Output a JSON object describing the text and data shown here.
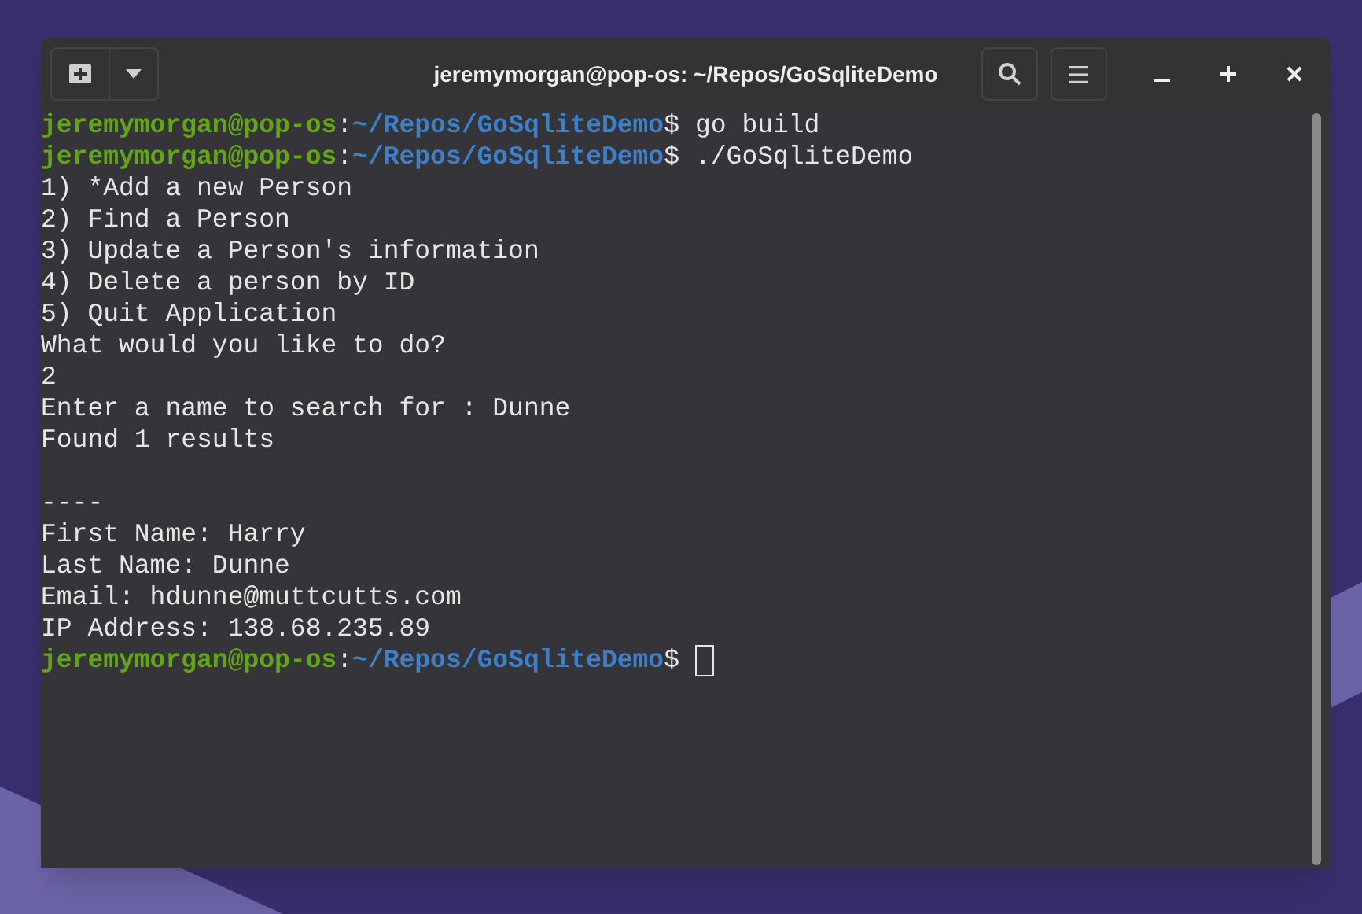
{
  "window": {
    "title": "jeremymorgan@pop-os: ~/Repos/GoSqliteDemo"
  },
  "terminal": {
    "lines": [
      {
        "kind": "prompt",
        "user": "jeremymorgan@pop-os",
        "separator": ":",
        "path": "~/Repos/GoSqliteDemo",
        "symbol": "$",
        "command": "go build"
      },
      {
        "kind": "prompt",
        "user": "jeremymorgan@pop-os",
        "separator": ":",
        "path": "~/Repos/GoSqliteDemo",
        "symbol": "$",
        "command": "./GoSqliteDemo"
      },
      {
        "kind": "output",
        "text": "1) *Add a new Person"
      },
      {
        "kind": "output",
        "text": "2) Find a Person"
      },
      {
        "kind": "output",
        "text": "3) Update a Person's information"
      },
      {
        "kind": "output",
        "text": "4) Delete a person by ID"
      },
      {
        "kind": "output",
        "text": "5) Quit Application"
      },
      {
        "kind": "output",
        "text": "What would you like to do?"
      },
      {
        "kind": "output",
        "text": "2"
      },
      {
        "kind": "output",
        "text": "Enter a name to search for : Dunne"
      },
      {
        "kind": "output",
        "text": "Found 1 results"
      },
      {
        "kind": "blank"
      },
      {
        "kind": "output",
        "text": "----"
      },
      {
        "kind": "output",
        "text": "First Name: Harry"
      },
      {
        "kind": "output",
        "text": "Last Name: Dunne"
      },
      {
        "kind": "output",
        "text": "Email: hdunne@muttcutts.com"
      },
      {
        "kind": "output",
        "text": "IP Address: 138.68.235.89"
      },
      {
        "kind": "prompt",
        "user": "jeremymorgan@pop-os",
        "separator": ":",
        "path": "~/Repos/GoSqliteDemo",
        "symbol": "$",
        "cursor": true
      }
    ]
  }
}
